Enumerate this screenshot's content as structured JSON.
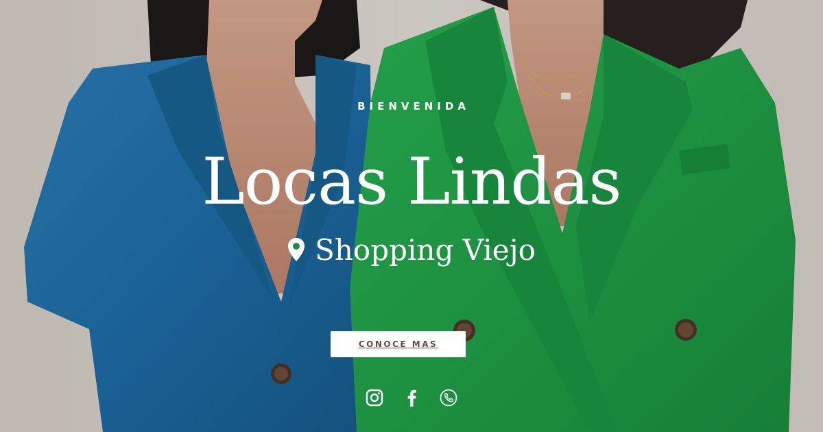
{
  "hero": {
    "eyebrow": "BIENVENIDA",
    "title": "Locas Lindas",
    "location": "Shopping Viejo",
    "location_icon": "map-pin-icon",
    "cta_label": "CONOCE MAS"
  },
  "social": {
    "items": [
      "instagram-icon",
      "facebook-icon",
      "phone-icon"
    ]
  },
  "colors": {
    "text": "#ffffff",
    "button_bg": "#ffffff",
    "button_text": "#6b4a3e",
    "blue_blazer": "#1f6fa8",
    "green_blazer": "#1e9a45",
    "background_wall": "#d6cfc8"
  }
}
